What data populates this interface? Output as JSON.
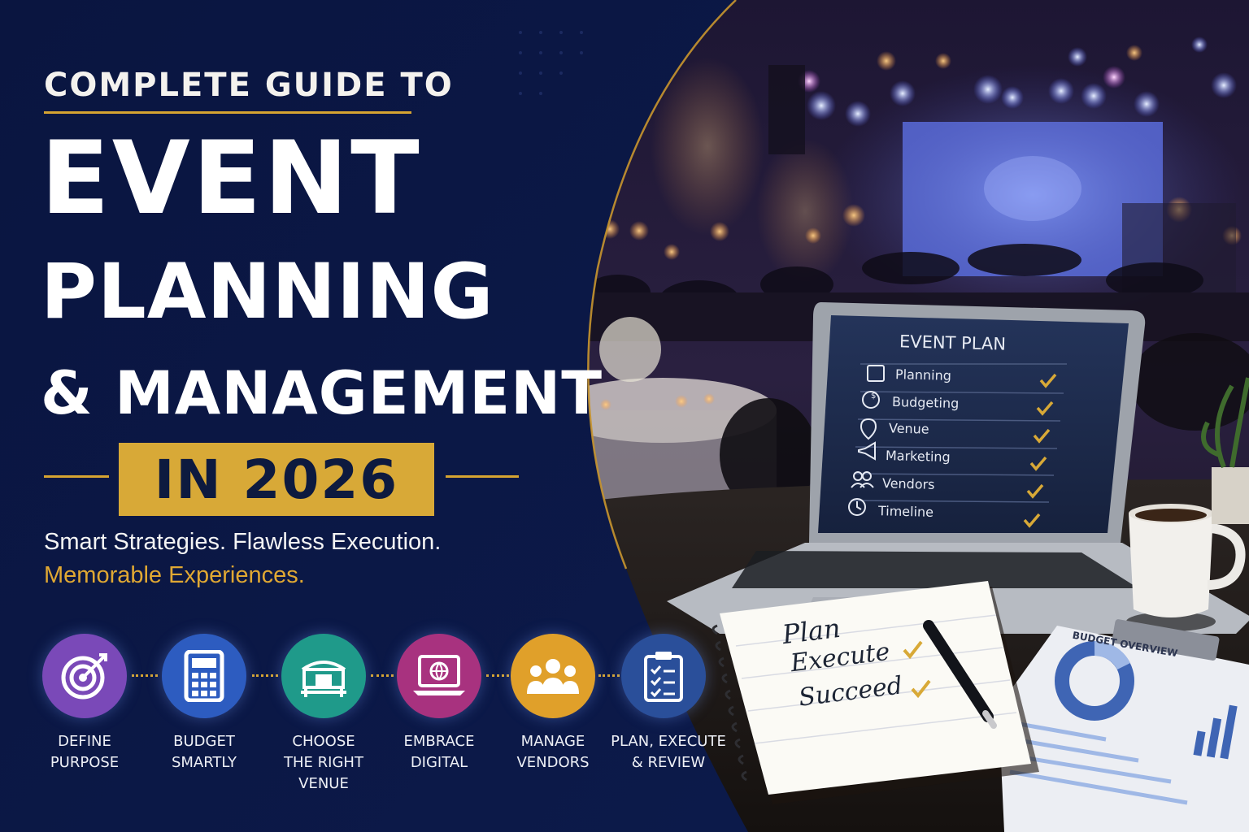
{
  "header": {
    "kicker": "COMPLETE GUIDE TO",
    "title_line_1": "EVENT",
    "title_line_2": "PLANNING",
    "title_line_3": "& MANAGEMENT",
    "year_label": "IN 2026"
  },
  "tagline": {
    "line_1": "Smart Strategies. Flawless Execution.",
    "line_2": "Memorable Experiences."
  },
  "steps": [
    {
      "label_1": "DEFINE",
      "label_2": "PURPOSE",
      "icon": "target-icon",
      "color": "#7a49b8"
    },
    {
      "label_1": "BUDGET",
      "label_2": "SMARTLY",
      "icon": "calculator-icon",
      "color": "#2d5cc0"
    },
    {
      "label_1": "CHOOSE",
      "label_2": "THE RIGHT VENUE",
      "icon": "venue-icon",
      "color": "#1f9a8a"
    },
    {
      "label_1": "EMBRACE",
      "label_2": "DIGITAL",
      "icon": "laptop-globe-icon",
      "color": "#a8327f"
    },
    {
      "label_1": "MANAGE",
      "label_2": "VENDORS",
      "icon": "people-icon",
      "color": "#e0a02a"
    },
    {
      "label_1": "PLAN, EXECUTE",
      "label_2": "& REVIEW",
      "icon": "checklist-icon",
      "color": "#2a4f9a"
    }
  ],
  "laptop_screen": {
    "title": "EVENT PLAN",
    "items": [
      {
        "label": "Planning",
        "icon": "calendar-icon"
      },
      {
        "label": "Budgeting",
        "icon": "dollar-icon"
      },
      {
        "label": "Venue",
        "icon": "location-pin-icon"
      },
      {
        "label": "Marketing",
        "icon": "megaphone-icon"
      },
      {
        "label": "Vendors",
        "icon": "people-icon"
      },
      {
        "label": "Timeline",
        "icon": "clock-icon"
      }
    ]
  },
  "notebook": {
    "line_1": "Plan",
    "line_2": "Execute",
    "line_3": "Succeed"
  },
  "report": {
    "title": "BUDGET OVERVIEW"
  },
  "colors": {
    "navy": "#0b1638",
    "gold": "#d8a937",
    "screen": "#1f2b4a"
  }
}
